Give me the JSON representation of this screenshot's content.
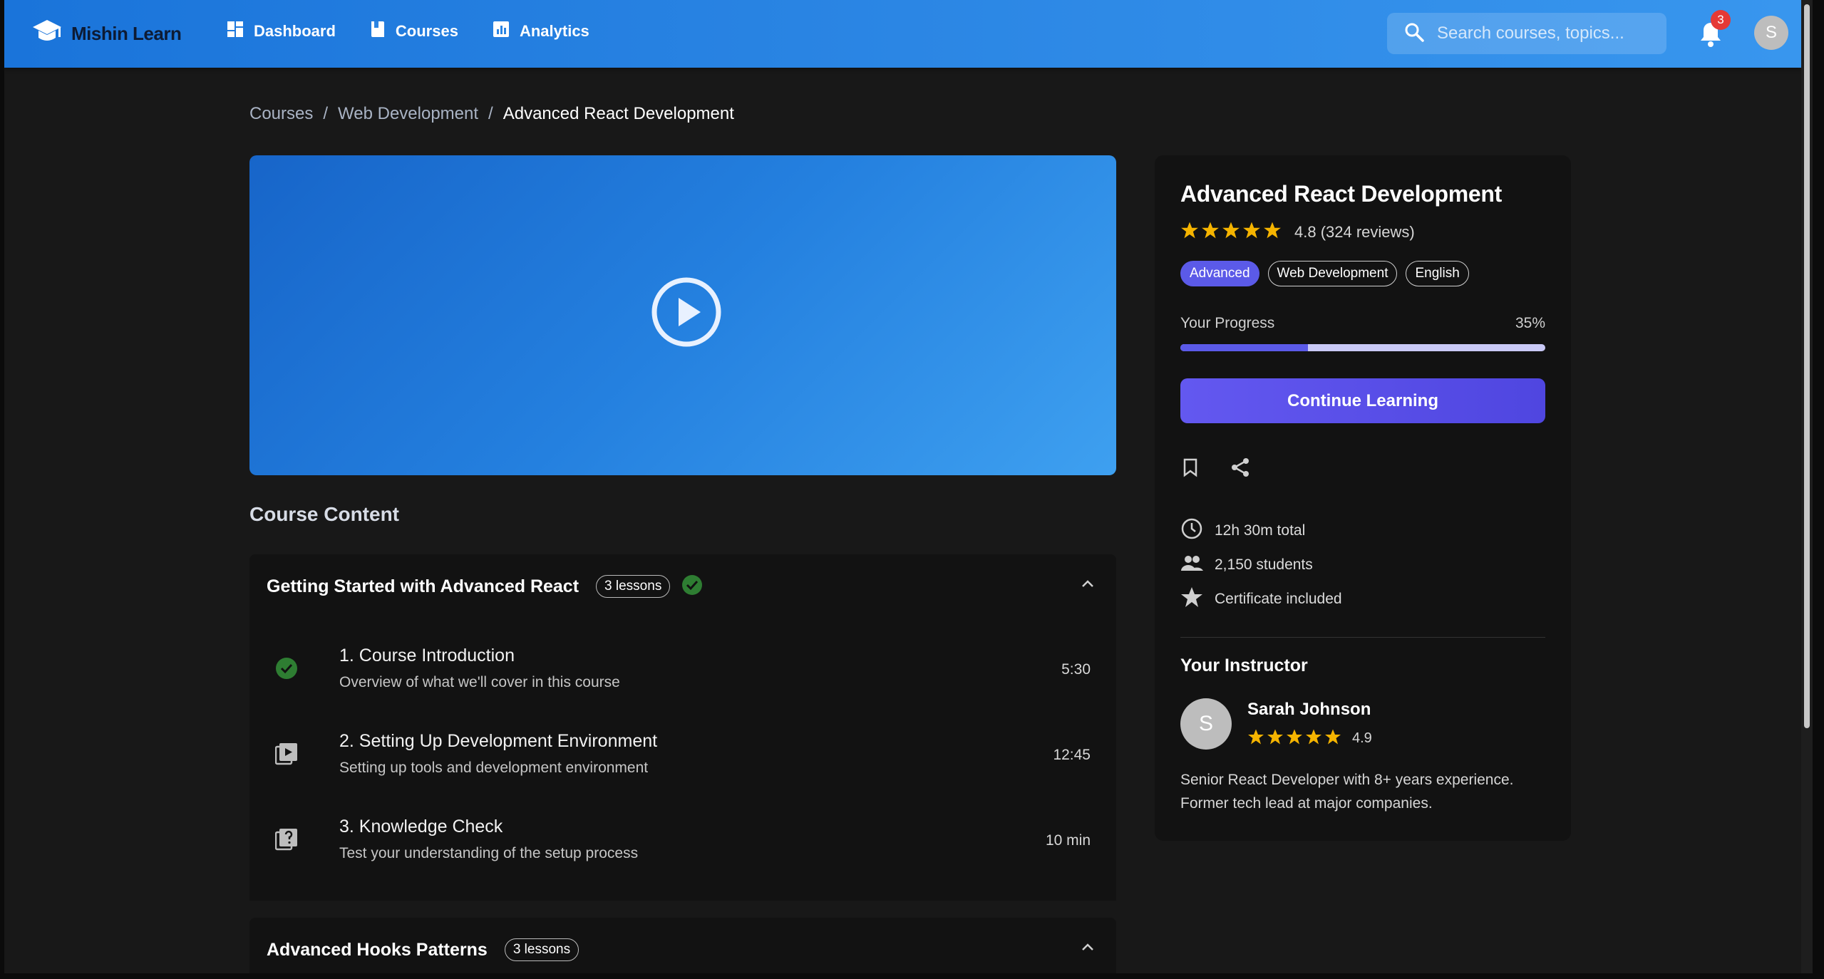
{
  "app": {
    "brand": "Mishin Learn",
    "nav": [
      {
        "label": "Dashboard",
        "icon": "dashboard-icon"
      },
      {
        "label": "Courses",
        "icon": "book-icon"
      },
      {
        "label": "Analytics",
        "icon": "analytics-icon"
      }
    ],
    "search_placeholder": "Search courses, topics...",
    "notification_count": "3",
    "user_initial": "S"
  },
  "breadcrumb": [
    {
      "label": "Courses"
    },
    {
      "label": "Web Development"
    },
    {
      "label": "Advanced React Development"
    }
  ],
  "breadcrumb_sep": "/",
  "main": {
    "section_heading": "Course Content",
    "modules": [
      {
        "title": "Getting Started with Advanced React",
        "lessons_badge": "3 lessons",
        "completed": true,
        "lessons": [
          {
            "title": "1. Course Introduction",
            "description": "Overview of what we'll cover in this course",
            "duration": "5:30",
            "icon": "check-circle-icon",
            "status": "completed"
          },
          {
            "title": "2. Setting Up Development Environment",
            "description": "Setting up tools and development environment",
            "duration": "12:45",
            "icon": "video-lesson-icon"
          },
          {
            "title": "3. Knowledge Check",
            "description": "Test your understanding of the setup process",
            "duration": "10 min",
            "icon": "quiz-icon"
          }
        ]
      },
      {
        "title": "Advanced Hooks Patterns",
        "lessons_badge": "3 lessons",
        "completed": false,
        "lessons": []
      }
    ]
  },
  "course": {
    "title": "Advanced React Development",
    "rating": 4.8,
    "rating_text": "4.8 (324 reviews)",
    "chips": [
      "Advanced",
      "Web Development",
      "English"
    ],
    "progress_label": "Your Progress",
    "progress_percent": 35,
    "progress_text": "35%",
    "cta": "Continue Learning",
    "meta": [
      {
        "icon": "clock-icon",
        "text": "12h 30m total"
      },
      {
        "icon": "people-icon",
        "text": "2,150 students"
      },
      {
        "icon": "star-icon",
        "text": "Certificate included"
      }
    ]
  },
  "instructor": {
    "heading": "Your Instructor",
    "initial": "S",
    "name": "Sarah Johnson",
    "rating": "4.9",
    "bio": "Senior React Developer with 8+ years experience. Former tech lead at major companies."
  },
  "colors": {
    "appbar_start": "#1a74da",
    "appbar_end": "#3896ee",
    "accent": "#5b5ae8",
    "success": "#2e7d32",
    "star": "#f5b400",
    "badge": "#e53935"
  }
}
